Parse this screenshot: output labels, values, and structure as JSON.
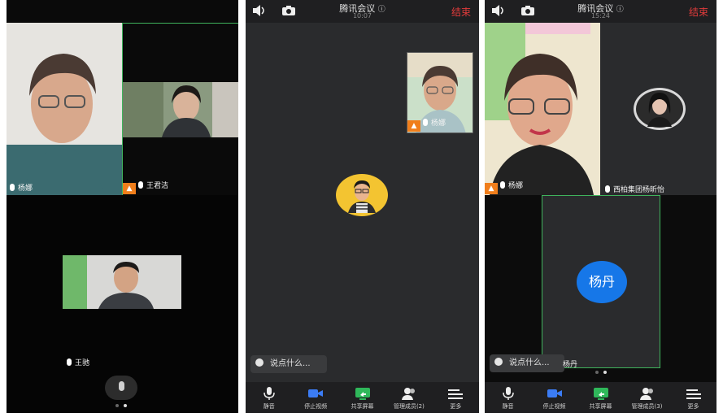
{
  "screen1": {
    "participants": [
      {
        "name": "杨娜"
      },
      {
        "name": "王君洁"
      },
      {
        "name": "王驰"
      }
    ]
  },
  "screen2": {
    "title": "腾讯会议",
    "time": "10:07",
    "end_label": "结束",
    "self_name": "杨娜",
    "chat_placeholder": "说点什么...",
    "toolbar": [
      {
        "label": "静音",
        "icon": "mic-icon"
      },
      {
        "label": "停止视频",
        "icon": "video-icon"
      },
      {
        "label": "共享屏幕",
        "icon": "share-screen-icon"
      },
      {
        "label": "管理成员(2)",
        "icon": "members-icon"
      },
      {
        "label": "更多",
        "icon": "more-icon"
      }
    ]
  },
  "screen3": {
    "title": "腾讯会议",
    "time": "15:24",
    "end_label": "结束",
    "participants": [
      {
        "name": "杨娜"
      },
      {
        "name": "西柏集团杨昕怡"
      },
      {
        "name": "杨丹"
      }
    ],
    "avatar_text": "杨丹",
    "chat_placeholder": "说点什么...",
    "chat_overlap_name": "杨丹",
    "toolbar": [
      {
        "label": "静音",
        "icon": "mic-icon"
      },
      {
        "label": "停止视频",
        "icon": "video-icon"
      },
      {
        "label": "共享屏幕",
        "icon": "share-screen-icon"
      },
      {
        "label": "管理成员(3)",
        "icon": "members-icon"
      },
      {
        "label": "更多",
        "icon": "more-icon"
      }
    ]
  },
  "colors": {
    "end_red": "#e23b3b",
    "host_orange": "#f07e1b",
    "avatar_blue": "#1677e8",
    "active_border": "#3fb35c"
  }
}
